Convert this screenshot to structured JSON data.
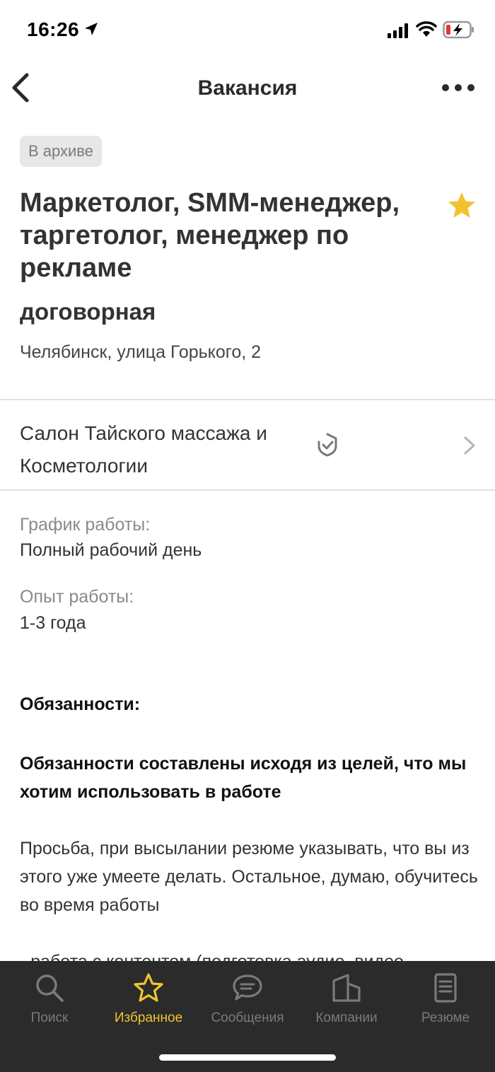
{
  "status_bar": {
    "time": "16:26",
    "icons": [
      "location-arrow-icon",
      "cellular-signal-icon",
      "wifi-icon",
      "battery-charging-icon"
    ]
  },
  "nav": {
    "title": "Вакансия",
    "back_icon": "chevron-left-icon",
    "more_icon": "more-dots-icon"
  },
  "vacancy": {
    "status_badge": "В архиве",
    "title": "Маркетолог, SMM-менеджер, таргетолог, менеджер по рекламе",
    "salary": "договорная",
    "address": "Челябинск, улица Горького, 2",
    "favorite_icon": "star-filled-icon",
    "favorite_color": "#f2c230"
  },
  "company": {
    "name": "Салон Тайского массажа и Косметологии",
    "verified_icon": "verified-shield-icon"
  },
  "details": {
    "schedule_label": "График работы:",
    "schedule_value": "Полный рабочий день",
    "experience_label": "Опыт работы:",
    "experience_value": "1-3 года"
  },
  "description": {
    "section_title": "Обязанности:",
    "bold_paragraph": "Обязанности составлены исходя из целей, что мы хотим использовать в работе",
    "paragraph": "Просьба, при высылании резюме указывать, что вы из этого уже умеете делать. Остальное, думаю, обучитесь во время работы",
    "partial_line": "- работа с контентом (подготовка аудио, видео"
  },
  "tab_bar": {
    "active_color": "#f0c52e",
    "tabs": [
      {
        "label": "Поиск",
        "icon": "search-icon",
        "active": false
      },
      {
        "label": "Избранное",
        "icon": "star-outline-icon",
        "active": true
      },
      {
        "label": "Сообщения",
        "icon": "message-bubble-icon",
        "active": false
      },
      {
        "label": "Компании",
        "icon": "building-icon",
        "active": false
      },
      {
        "label": "Резюме",
        "icon": "document-icon",
        "active": false
      }
    ]
  }
}
